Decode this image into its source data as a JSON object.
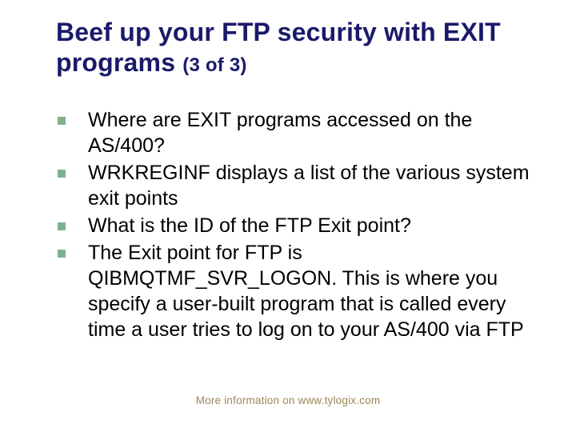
{
  "title_main": "Beef up your FTP security with EXIT programs ",
  "title_sub": "(3 of 3)",
  "bullets": [
    {
      "text": "Where are EXIT programs accessed on the AS/400?"
    },
    {
      "text": "WRKREGINF displays a list of the various system exit points"
    },
    {
      "text": "What is the ID of the FTP Exit point?"
    },
    {
      "text": "The Exit point for FTP is QIBMQTMF_SVR_LOGON. This is where you specify a user-built program that is called every time a user tries to log on to your AS/400 via FTP"
    }
  ],
  "bullet_color": "#7fb28a",
  "footer": "More information on www.tylogix.com"
}
